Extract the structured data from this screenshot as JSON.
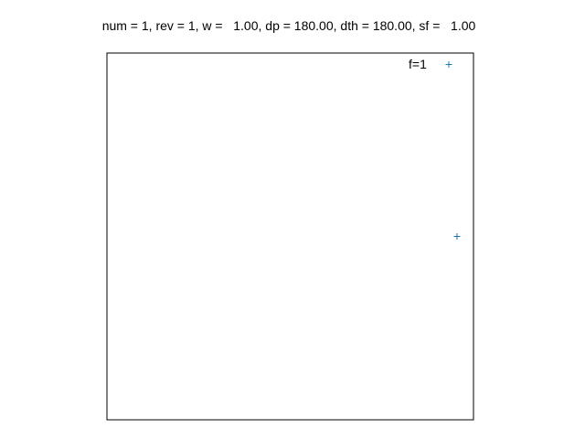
{
  "chart_data": {
    "type": "scatter",
    "title": "num = 1, rev = 1, w =   1.00, dp = 180.00, dth = 180.00, sf =   1.00",
    "xlim": [
      -1,
      1
    ],
    "ylim": [
      -1,
      1
    ],
    "grid": false,
    "legend": {
      "placement": "top-right",
      "entries": [
        {
          "label": "f=1",
          "marker": "plus",
          "color": "#1f77b4"
        }
      ]
    },
    "series": [
      {
        "name": "f=1",
        "marker": "plus",
        "color": "#1f77b4",
        "points": [
          {
            "x": 0.91,
            "y": 0.0
          }
        ]
      }
    ]
  }
}
